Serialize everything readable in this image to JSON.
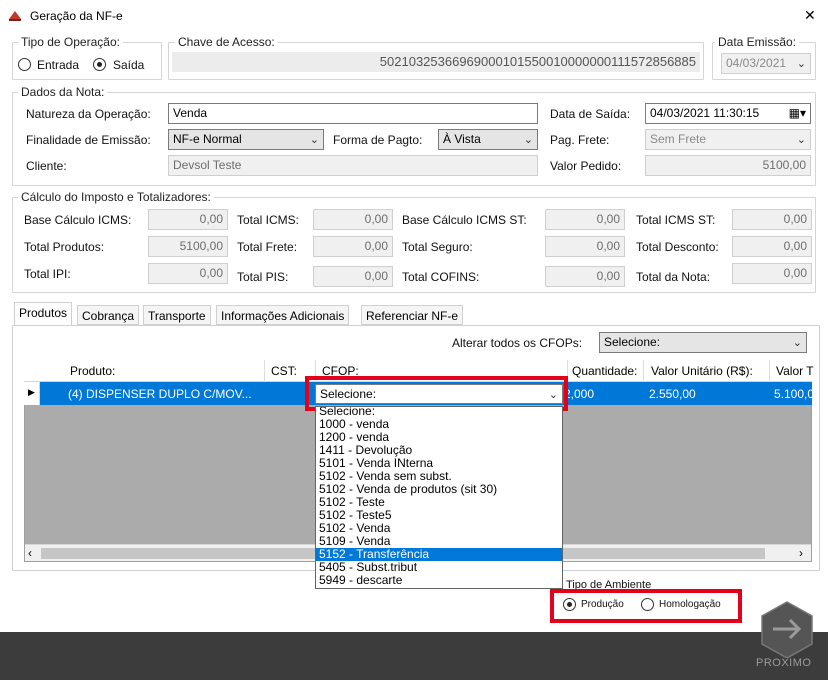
{
  "window": {
    "title": "Geração da NF-e",
    "close": "✕"
  },
  "tipo_operacao": {
    "legend": "Tipo de Operação:",
    "entrada": "Entrada",
    "saida": "Saída",
    "selected": "Saída"
  },
  "chave": {
    "legend": "Chave de Acesso:",
    "value": "50210325366969000101550010000000111572856885"
  },
  "data_emissao": {
    "legend": "Data Emissão:",
    "value": "04/03/2021"
  },
  "dados": {
    "legend": "Dados da Nota:",
    "natureza_label": "Natureza da Operação:",
    "natureza_value": "Venda",
    "data_saida_label": "Data de Saída:",
    "data_saida_value": "04/03/2021 11:30:15",
    "finalidade_label": "Finalidade de Emissão:",
    "finalidade_value": "NF-e Normal",
    "forma_pagto_label": "Forma de Pagto:",
    "forma_pagto_value": "À Vista",
    "pag_frete_label": "Pag. Frete:",
    "pag_frete_value": "Sem Frete",
    "cliente_label": "Cliente:",
    "cliente_value": "Devsol Teste",
    "valor_pedido_label": "Valor Pedido:",
    "valor_pedido_value": "5100,00"
  },
  "calculo": {
    "legend": "Cálculo do Imposto e Totalizadores:",
    "base_icms_label": "Base Cálculo ICMS:",
    "base_icms": "0,00",
    "total_icms_label": "Total ICMS:",
    "total_icms": "0,00",
    "base_icms_st_label": "Base Cálculo ICMS ST:",
    "base_icms_st": "0,00",
    "total_icms_st_label": "Total ICMS ST:",
    "total_icms_st": "0,00",
    "total_produtos_label": "Total Produtos:",
    "total_produtos": "5100,00",
    "total_frete_label": "Total Frete:",
    "total_frete": "0,00",
    "total_seguro_label": "Total Seguro:",
    "total_seguro": "0,00",
    "total_desconto_label": "Total Desconto:",
    "total_desconto": "0,00",
    "total_ipi_label": "Total IPI:",
    "total_ipi": "0,00",
    "total_pis_label": "Total PIS:",
    "total_pis": "0,00",
    "total_cofins_label": "Total COFINS:",
    "total_cofins": "0,00",
    "total_nota_label": "Total da Nota:",
    "total_nota": "0,00"
  },
  "tabs": [
    "Produtos",
    "Cobrança",
    "Transporte",
    "Informações Adicionais",
    "Referenciar NF-e"
  ],
  "cfops_all": {
    "label": "Alterar todos os CFOPs:",
    "value": "Selecione:"
  },
  "grid": {
    "columns": [
      "Produto:",
      "CST:",
      "CFOP:",
      "Quantidade:",
      "Valor Unitário (R$):",
      "Valor T"
    ],
    "row": {
      "produto": "(4) DISPENSER DUPLO C/MOV...",
      "cst": "",
      "cfop": "Selecione:",
      "quantidade": "2,000",
      "valor_unitario": "2.550,00",
      "valor_total": "5.100,0"
    }
  },
  "cfop_dropdown": {
    "options": [
      "Selecione:",
      "1000 - venda",
      "1200 - venda",
      "1411 - Devolução",
      "5101 - Venda INterna",
      "5102 - Venda sem subst.",
      "5102 - Venda de produtos (sit 30)",
      "5102 - Teste",
      "5102 - Teste5",
      "5102 - Venda",
      "5109 - Venda",
      "5152 - Transferência",
      "5405 - Subst.tribut",
      "5949 - descarte"
    ],
    "highlighted": "5152 - Transferência"
  },
  "ambiente": {
    "legend": "Tipo de Ambiente",
    "producao": "Produção",
    "homologacao": "Homologação",
    "selected": "Produção"
  },
  "footer": {
    "next_label": "PROXIMO"
  },
  "colors": {
    "selection": "#0078d7",
    "annotation": "#e3001b",
    "footer_bg": "#3c3c3c"
  }
}
